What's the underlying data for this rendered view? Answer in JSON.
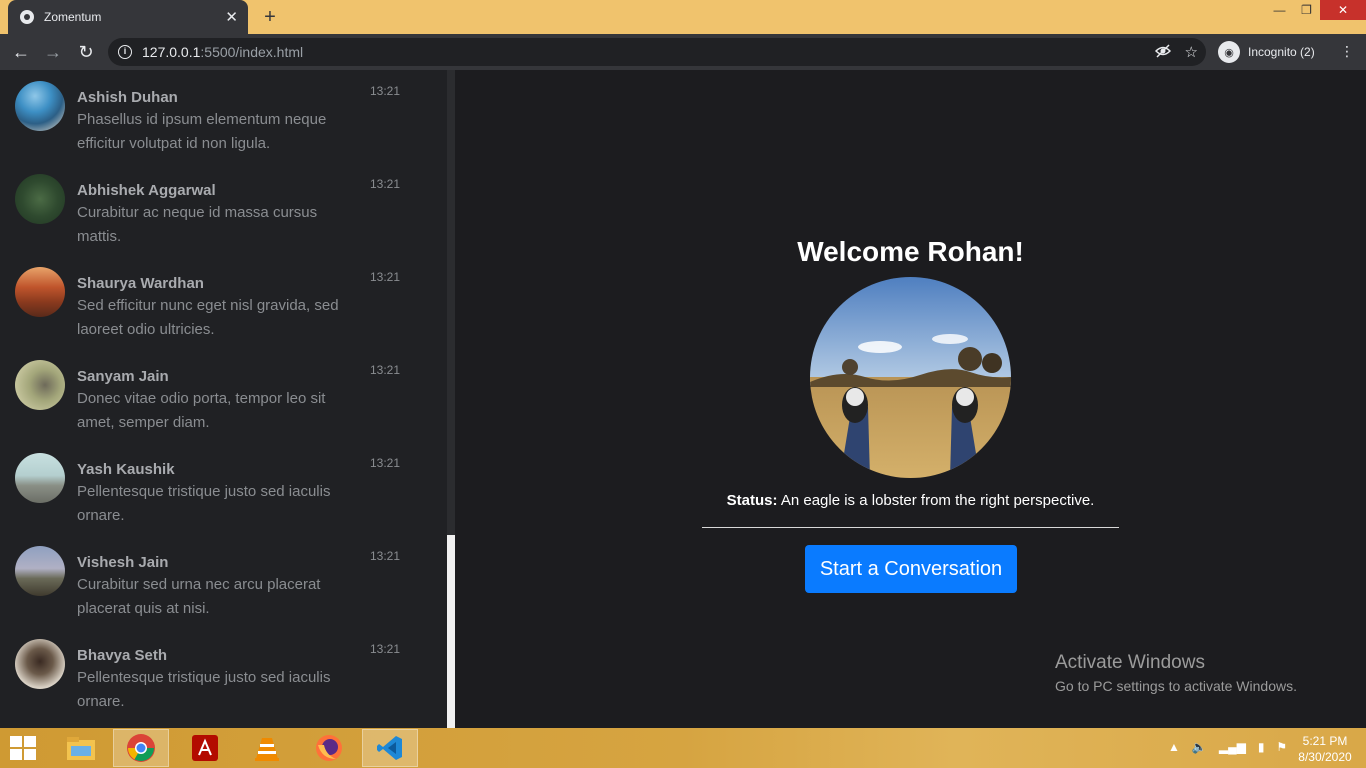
{
  "browser": {
    "tab_title": "Zomentum",
    "url_host": "127.0.0.1",
    "url_path": ":5500/index.html",
    "incognito_label": "Incognito (2)"
  },
  "chats": [
    {
      "name": "Ashish Duhan",
      "message": "Phasellus id ipsum elementum neque efficitur volutpat id non ligula.",
      "time": "13:21"
    },
    {
      "name": "Abhishek Aggarwal",
      "message": "Curabitur ac neque id massa cursus mattis.",
      "time": "13:21"
    },
    {
      "name": "Shaurya Wardhan",
      "message": "Sed efficitur nunc eget nisl gravida, sed laoreet odio ultricies.",
      "time": "13:21"
    },
    {
      "name": "Sanyam Jain",
      "message": "Donec vitae odio porta, tempor leo sit amet, semper diam.",
      "time": "13:21"
    },
    {
      "name": "Yash Kaushik",
      "message": "Pellentesque tristique justo sed iaculis ornare.",
      "time": "13:21"
    },
    {
      "name": "Vishesh Jain",
      "message": "Curabitur sed urna nec arcu placerat placerat quis at nisi.",
      "time": "13:21"
    },
    {
      "name": "Bhavya Seth",
      "message": "Pellentesque tristique justo sed iaculis ornare.",
      "time": "13:21"
    }
  ],
  "main": {
    "welcome": "Welcome Rohan!",
    "status_label": "Status:",
    "status_text": "An eagle is a lobster from the right perspective.",
    "cta_label": "Start a Conversation"
  },
  "watermark": {
    "line1": "Activate Windows",
    "line2": "Go to PC settings to activate Windows."
  },
  "taskbar": {
    "time": "5:21 PM",
    "date": "8/30/2020"
  },
  "colors": {
    "accent": "#0a7bff",
    "taskbar": "#d6a441",
    "tabstrip": "#f0c36d"
  }
}
